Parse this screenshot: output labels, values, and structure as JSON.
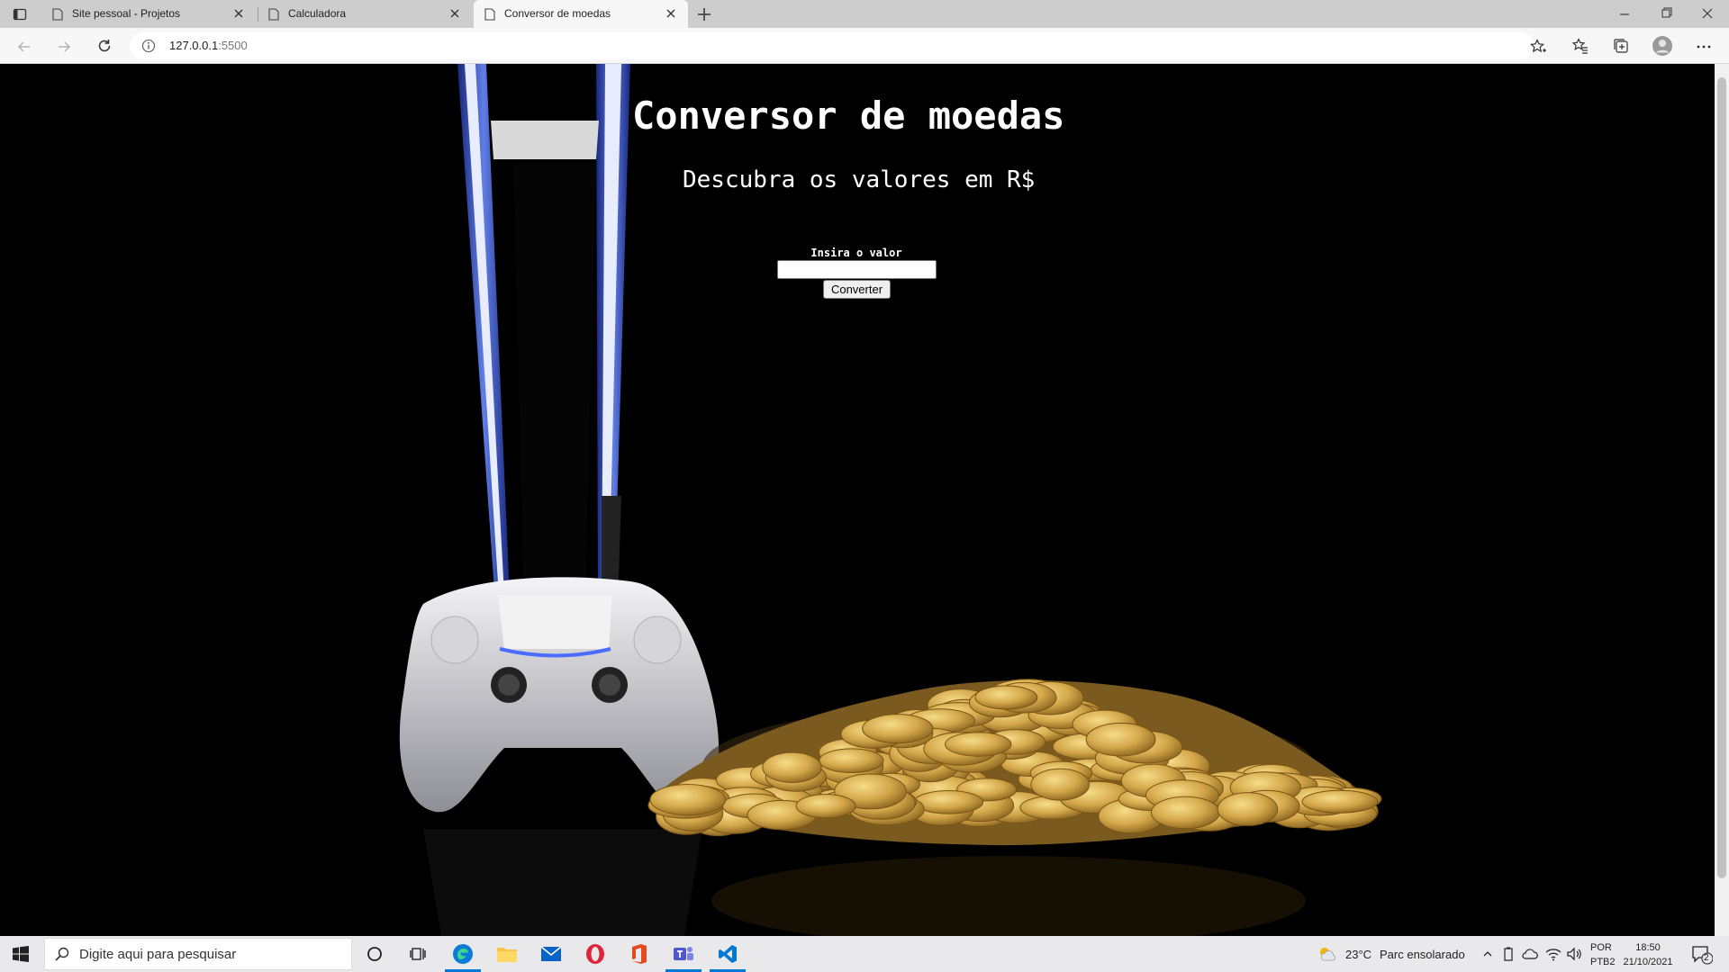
{
  "browser": {
    "tabs": [
      {
        "label": "Site pessoal - Projetos"
      },
      {
        "label": "Calculadora"
      },
      {
        "label": "Conversor de moedas"
      }
    ],
    "url_host": "127.0.0.1",
    "url_port": ":5500"
  },
  "page": {
    "title": "Conversor de moedas",
    "subtitle": "Descubra os valores em R$",
    "input_label": "Insira o valor",
    "input_value": "",
    "convert_button": "Converter"
  },
  "taskbar": {
    "search_placeholder": "Digite aqui para pesquisar",
    "weather": "23°C",
    "weather_desc": "Parc ensolarado",
    "lang_top": "POR",
    "lang_bottom": "PTB2",
    "time": "18:50",
    "date": "21/10/2021",
    "notification_count": "2"
  },
  "colors": {
    "page_background": "#000000",
    "taskbar_accent": "#0078d4",
    "coin_gold": "#d4a84a"
  }
}
